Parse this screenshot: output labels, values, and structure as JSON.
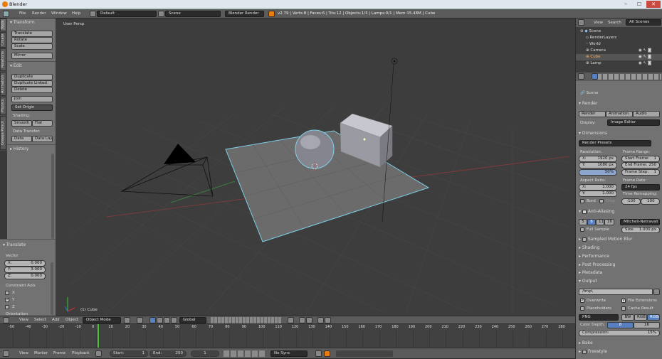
{
  "window": {
    "title": "Blender"
  },
  "topbar": {
    "menus": [
      "File",
      "Render",
      "Window",
      "Help"
    ],
    "layout": "Default",
    "scene": "Scene",
    "engine": "Blender Render",
    "stats": "v2.79 | Verts:8 | Faces:6 | Tris:12 | Objects:1/3 | Lamps:0/1 | Mem:15.48M | Cube"
  },
  "tool_tabs": [
    "Tools",
    "Create",
    "Relations",
    "Animation",
    "Physics",
    "Grease Pencil"
  ],
  "tools": {
    "transform_header": "Transform",
    "translate": "Translate",
    "rotate": "Rotate",
    "scale": "Scale",
    "mirror": "Mirror",
    "edit_header": "Edit",
    "duplicate": "Duplicate",
    "duplicate_linked": "Duplicate Linked",
    "delete": "Delete",
    "join": "Join",
    "set_origin": "Set Origin",
    "shading": "Shading:",
    "smooth": "Smooth",
    "flat": "Flat",
    "data_transfer": "Data Transfer:",
    "data": "Data",
    "data_layo": "Data Layo",
    "history": "History"
  },
  "operator": {
    "header": "Translate",
    "vector": "Vector",
    "x": "X:",
    "xv": "0.000",
    "y": "Y:",
    "yv": "3.000",
    "z": "Z:",
    "zv": "0.000",
    "constraint": "Constraint Axis",
    "cx": "X",
    "cy": "Y",
    "cz": "Z",
    "orientation": "Orientation"
  },
  "viewport": {
    "label": "User Persp",
    "object": "(1) Cube"
  },
  "viewport_header": {
    "menus": [
      "View",
      "Select",
      "Add",
      "Object"
    ],
    "mode": "Object Mode",
    "orientation": "Global"
  },
  "timeline": {
    "ticks": [
      "-50",
      "-40",
      "-30",
      "-20",
      "-10",
      "0",
      "10",
      "20",
      "30",
      "40",
      "50",
      "60",
      "70",
      "80",
      "90",
      "100",
      "110",
      "120",
      "130",
      "140",
      "150",
      "160",
      "170",
      "180",
      "190",
      "200",
      "210",
      "220",
      "230",
      "240",
      "250",
      "260",
      "270",
      "280"
    ],
    "menus": [
      "View",
      "Marker",
      "Frame",
      "Playback"
    ],
    "start_label": "Start:",
    "start": "1",
    "end_label": "End:",
    "end": "250",
    "current": "1",
    "sync": "No Sync",
    "current_frame": 1
  },
  "outliner": {
    "menus": [
      "View",
      "Search",
      "All Scenes"
    ],
    "items": [
      "Scene",
      "RenderLayers",
      "World",
      "Camera",
      "Cube",
      "Lamp"
    ]
  },
  "properties": {
    "scene": "Scene",
    "render_header": "Render",
    "render_btn": "Render",
    "animation_btn": "Animation",
    "audio_btn": "Audio",
    "display_label": "Display:",
    "display": "Image Editor",
    "dimensions": "Dimensions",
    "presets": "Render Presets",
    "resolution": "Resolution:",
    "res_x": "X:",
    "res_xv": "1920 px",
    "res_y": "Y:",
    "res_yv": "1080 px",
    "res_pct": "50%",
    "frame_range": "Frame Range:",
    "start_frame": "Start Frame:",
    "start_frame_v": "1",
    "end_frame": "End Frame:",
    "end_frame_v": "250",
    "frame_step": "Frame Step:",
    "frame_step_v": "1",
    "aspect": "Aspect Ratio:",
    "asp_x": "X:",
    "asp_xv": "1.000",
    "asp_y": "Y:",
    "asp_yv": "1.000",
    "bord": "Bord",
    "crop": "Crop",
    "frame_rate": "Frame Rate:",
    "fps": "24 fps",
    "remap": "Time Remapping:",
    "remap_old": "·100",
    "remap_new": "·100",
    "aa": "Anti-Aliasing",
    "aa_samples": [
      "5",
      "8",
      "11",
      "16"
    ],
    "filter": "Mitchell-Netravali",
    "full_sample": "Full Sample",
    "size": "Size:",
    "size_v": "1.000 px",
    "collapsed": [
      "Sampled Motion Blur",
      "Shading",
      "Performance",
      "Post Processing",
      "Metadata"
    ],
    "output": "Output",
    "path": "/tmp\\",
    "overwrite": "Overwrite",
    "file_ext": "File Extensions",
    "placeholders": "Placeholders",
    "cache": "Cache Result",
    "format": "PNG",
    "bw": "BW",
    "rgb": "RGB",
    "rgba": "RGBA",
    "depth_label": "Color Depth:",
    "depth8": "8",
    "depth16": "16",
    "compression": "Compression:",
    "compression_v": "15%",
    "bake": "Bake",
    "freestyle": "Freestyle"
  },
  "colors": {
    "accent": "#5680c2",
    "selected_outline": "#7fd0e8",
    "frame_line": "#4fbf3a"
  }
}
